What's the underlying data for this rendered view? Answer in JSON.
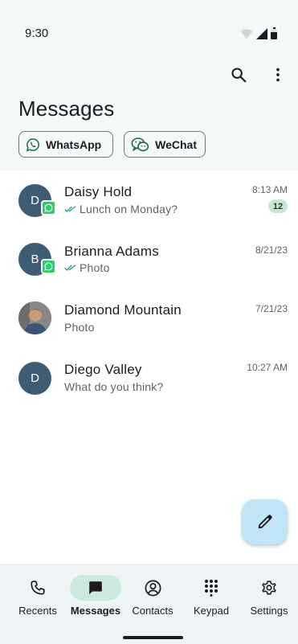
{
  "status_bar": {
    "time": "9:30"
  },
  "header": {
    "title": "Messages",
    "search_icon": "search-icon",
    "more_icon": "more-vert-icon"
  },
  "filters": [
    {
      "label": "WhatsApp",
      "icon": "whatsapp-icon"
    },
    {
      "label": "WeChat",
      "icon": "wechat-icon"
    }
  ],
  "conversations": [
    {
      "name": "Daisy Hold",
      "initial": "D",
      "preview": "Lunch on Monday?",
      "time": "8:13 AM",
      "unread": "12",
      "whatsapp": true,
      "read_receipt": true
    },
    {
      "name": "Brianna Adams",
      "initial": "B",
      "preview": "Photo",
      "time": "8/21/23",
      "whatsapp": true,
      "read_receipt": true
    },
    {
      "name": "Diamond Mountain",
      "initial": "",
      "preview": "Photo",
      "time": "7/21/23",
      "whatsapp": false,
      "photo_avatar": true
    },
    {
      "name": "Diego Valley",
      "initial": "D",
      "preview": "What do you think?",
      "time": "10:27 AM",
      "whatsapp": false
    }
  ],
  "fab": {
    "icon": "pencil-icon"
  },
  "bottom_nav": [
    {
      "label": "Recents",
      "icon": "phone-icon"
    },
    {
      "label": "Messages",
      "icon": "chat-icon",
      "active": true
    },
    {
      "label": "Contacts",
      "icon": "account-circle-icon"
    },
    {
      "label": "Keypad",
      "icon": "dialpad-icon"
    },
    {
      "label": "Settings",
      "icon": "gear-icon"
    }
  ],
  "colors": {
    "header_bg": "#f3f8f8",
    "avatar_bg": "#3e5c74",
    "whatsapp_green": "#25d366",
    "active_nav_pill": "#cde8dd",
    "fab_bg": "#bfe5f7",
    "unread_badge_bg": "#c8e6d4"
  }
}
